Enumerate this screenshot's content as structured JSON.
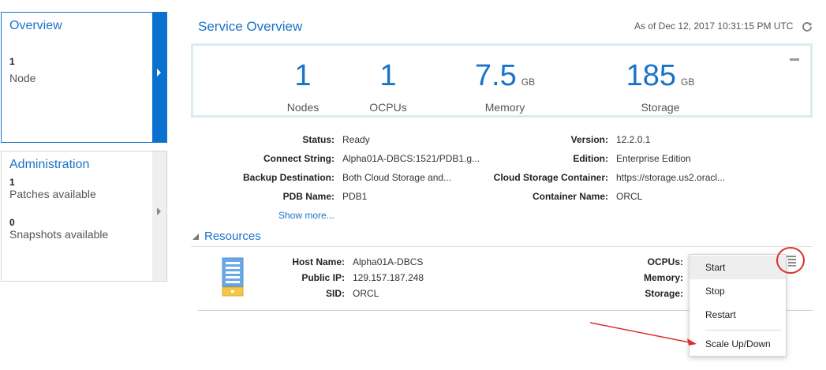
{
  "left_panels": {
    "overview": {
      "title": "Overview",
      "count": "1",
      "label": "Node"
    },
    "administration": {
      "title": "Administration",
      "patches_count": "1",
      "patches_label": "Patches available",
      "snapshots_count": "0",
      "snapshots_label": "Snapshots available"
    }
  },
  "header": {
    "title": "Service Overview",
    "as_of": "As of Dec 12, 2017 10:31:15 PM UTC"
  },
  "metrics": [
    {
      "value": "1",
      "unit": "",
      "label": "Nodes"
    },
    {
      "value": "1",
      "unit": "",
      "label": "OCPUs"
    },
    {
      "value": "7.5",
      "unit": "GB",
      "label": "Memory"
    },
    {
      "value": "185",
      "unit": "GB",
      "label": "Storage"
    }
  ],
  "details": {
    "left": [
      {
        "label": "Status:",
        "value": "Ready"
      },
      {
        "label": "Connect String:",
        "value": "Alpha01A-DBCS:1521/PDB1.g..."
      },
      {
        "label": "Backup Destination:",
        "value": "Both Cloud Storage and..."
      },
      {
        "label": "PDB Name:",
        "value": "PDB1"
      }
    ],
    "right": [
      {
        "label": "Version:",
        "value": "12.2.0.1"
      },
      {
        "label": "Edition:",
        "value": "Enterprise Edition"
      },
      {
        "label": "Cloud Storage Container:",
        "value": "https://storage.us2.oracl..."
      },
      {
        "label": "Container Name:",
        "value": "ORCL"
      }
    ],
    "show_more": "Show more..."
  },
  "resources": {
    "title": "Resources",
    "node": [
      {
        "label": "Host Name:",
        "value": "Alpha01A-DBCS"
      },
      {
        "label": "Public IP:",
        "value": "129.157.187.248"
      },
      {
        "label": "SID:",
        "value": "ORCL"
      }
    ],
    "right_labels": [
      "OCPUs:",
      "Memory:",
      "Storage:"
    ]
  },
  "action_menu": {
    "items": [
      "Start",
      "Stop",
      "Restart",
      "Scale Up/Down"
    ]
  },
  "colors": {
    "accent": "#1a73c8",
    "annotation_red": "#d9302d",
    "server_icon_blue": "#6aa8e8",
    "server_icon_yellow": "#f3c84a"
  },
  "icons": [
    "refresh-icon",
    "minimize-icon",
    "collapse-triangle-icon",
    "database-server-icon",
    "hamburger-menu-icon",
    "chevron-right-icon"
  ]
}
